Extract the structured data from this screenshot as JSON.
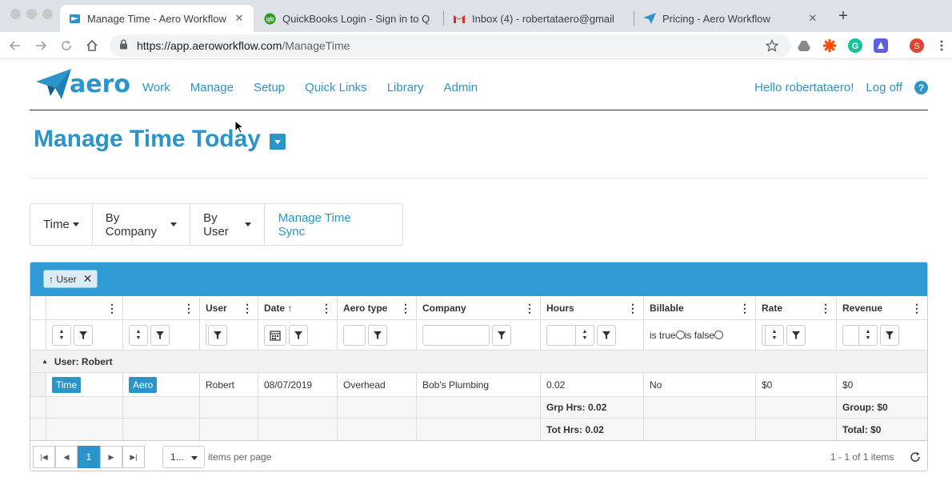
{
  "browser": {
    "tabs": [
      {
        "title": "Manage Time - Aero Workflow",
        "icon": "aero-tab-icon",
        "active": true
      },
      {
        "title": "QuickBooks Login - Sign in to Q",
        "icon": "quickbooks-icon",
        "active": false
      },
      {
        "title": "Inbox (4) - robertataero@gmail",
        "icon": "gmail-icon",
        "active": false
      },
      {
        "title": "Pricing - Aero Workflow",
        "icon": "aero-plane-icon",
        "active": false
      }
    ],
    "url_host": "https://app.aeroworkflow.com",
    "url_path": "/ManageTime"
  },
  "app": {
    "logo_text": "aero",
    "nav": [
      "Work",
      "Manage",
      "Setup",
      "Quick Links",
      "Library",
      "Admin"
    ],
    "greeting": "Hello robertataero!",
    "logoff": "Log off",
    "help": "?"
  },
  "page": {
    "title": "Manage Time Today"
  },
  "subnav": {
    "time": "Time",
    "by_company": "By Company",
    "by_user": "By User",
    "sync": "Manage Time Sync"
  },
  "grid": {
    "group_chip": "↑ User",
    "columns": [
      "",
      "",
      "User",
      "Date ↑",
      "Aero type",
      "Company",
      "Hours",
      "Billable",
      "Rate",
      "Revenue"
    ],
    "billable_filter": {
      "is_true": "is true",
      "is_false": "is false"
    },
    "group_header": "User: Robert",
    "row": {
      "time_btn": "Time",
      "aero_btn": "Aero",
      "user": "Robert",
      "date": "08/07/2019",
      "aero_type": "Overhead",
      "company": "Bob's Plumbing",
      "hours": "0.02",
      "billable": "No",
      "rate": "$0",
      "revenue": "$0"
    },
    "group_footer": {
      "hours": "Grp Hrs: 0.02",
      "revenue": "Group: $0"
    },
    "total_footer": {
      "hours": "Tot Hrs: 0.02",
      "revenue": "Total: $0"
    }
  },
  "pager": {
    "current_page": "1",
    "page_size": "1...",
    "items_per_page": "items per page",
    "info": "1 - 1 of 1 items"
  },
  "colors": {
    "accent": "#2b94c9",
    "groupbar": "#2f9ad3"
  }
}
